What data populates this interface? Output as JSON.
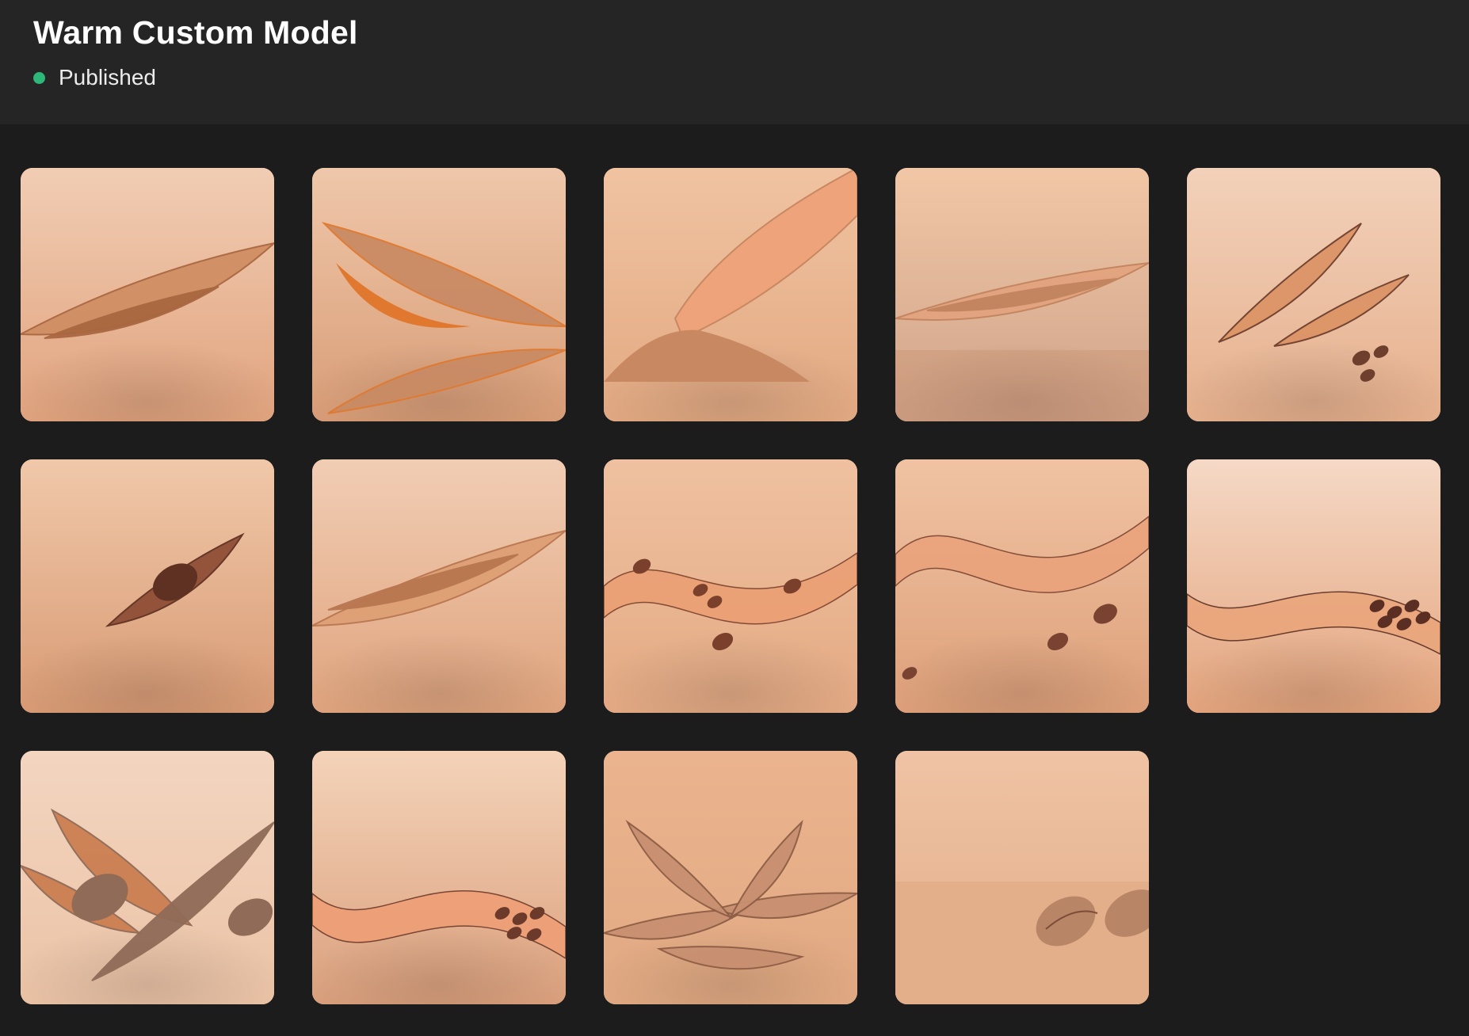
{
  "model": {
    "title": "Warm Custom Model",
    "status_label": "Published",
    "status_color": "#2db87a"
  },
  "gallery": {
    "images": [
      {
        "name": "gallery-image-1",
        "motif": "curled-leaf-lying",
        "colors": {
          "bg_top": "#f1cdb4",
          "bg_bottom": "#e1a37e",
          "main": "#d08e63",
          "dark": "#a96741"
        }
      },
      {
        "name": "gallery-image-2",
        "motif": "leaf-pod-with-reflection",
        "colors": {
          "bg_top": "#efc7aa",
          "bg_bottom": "#d99d77",
          "main": "#c98b64",
          "dark": "#e0792f"
        }
      },
      {
        "name": "gallery-image-3",
        "motif": "scoop-with-sand",
        "colors": {
          "bg_top": "#f0c3a1",
          "bg_bottom": "#e2a982",
          "main": "#eea37a",
          "dark": "#c88862"
        }
      },
      {
        "name": "gallery-image-4",
        "motif": "layered-leaves-reflection",
        "colors": {
          "bg_top": "#f1c7a6",
          "bg_bottom": "#cfa38a",
          "main": "#e3a47f",
          "dark": "#c2845e"
        }
      },
      {
        "name": "gallery-image-5",
        "motif": "two-leaves-with-seeds",
        "colors": {
          "bg_top": "#f2d1ba",
          "bg_bottom": "#e6b08d",
          "main": "#dc9466",
          "dark": "#6e3f2d"
        }
      },
      {
        "name": "gallery-image-6",
        "motif": "single-seed-pod",
        "colors": {
          "bg_top": "#f0c8a9",
          "bg_bottom": "#d99b75",
          "main": "#8f4f37",
          "dark": "#5f3122"
        }
      },
      {
        "name": "gallery-image-7",
        "motif": "two-big-pods",
        "colors": {
          "bg_top": "#f1cdb4",
          "bg_bottom": "#e0a47e",
          "main": "#dea075",
          "dark": "#b97650"
        }
      },
      {
        "name": "gallery-image-8",
        "motif": "ribbon-flying-seeds",
        "colors": {
          "bg_top": "#efc1a0",
          "bg_bottom": "#e4aa84",
          "main": "#ec9f74",
          "dark": "#7a402b"
        }
      },
      {
        "name": "gallery-image-9",
        "motif": "ribbon-wave-seeds",
        "colors": {
          "bg_top": "#f0c3a3",
          "bg_bottom": "#dea07a",
          "main": "#eaa37c",
          "dark": "#7a4331"
        }
      },
      {
        "name": "gallery-image-10",
        "motif": "ribbon-wave-seed-pile",
        "colors": {
          "bg_top": "#f5d9c6",
          "bg_bottom": "#e4a47d",
          "main": "#eaa67c",
          "dark": "#5a2e22"
        }
      },
      {
        "name": "gallery-image-11",
        "motif": "almonds-and-leaves",
        "colors": {
          "bg_top": "#f3d5c0",
          "bg_bottom": "#ebc3a6",
          "main": "#cc7f51",
          "dark": "#8f6b58"
        }
      },
      {
        "name": "gallery-image-12",
        "motif": "wave-with-seed-pile",
        "colors": {
          "bg_top": "#f4d3b9",
          "bg_bottom": "#dba07d",
          "main": "#ef9f75",
          "dark": "#6c3a2b"
        }
      },
      {
        "name": "gallery-image-13",
        "motif": "almond-star-cluster",
        "colors": {
          "bg_top": "#ebb48e",
          "bg_bottom": "#e2aa83",
          "main": "#c89071",
          "dark": "#8d5d45"
        }
      },
      {
        "name": "gallery-image-14",
        "motif": "almonds-on-table",
        "colors": {
          "bg_top": "#efc3a4",
          "bg_bottom": "#e3ae8a",
          "main": "#b98567",
          "dark": "#7b4c37"
        }
      }
    ]
  }
}
